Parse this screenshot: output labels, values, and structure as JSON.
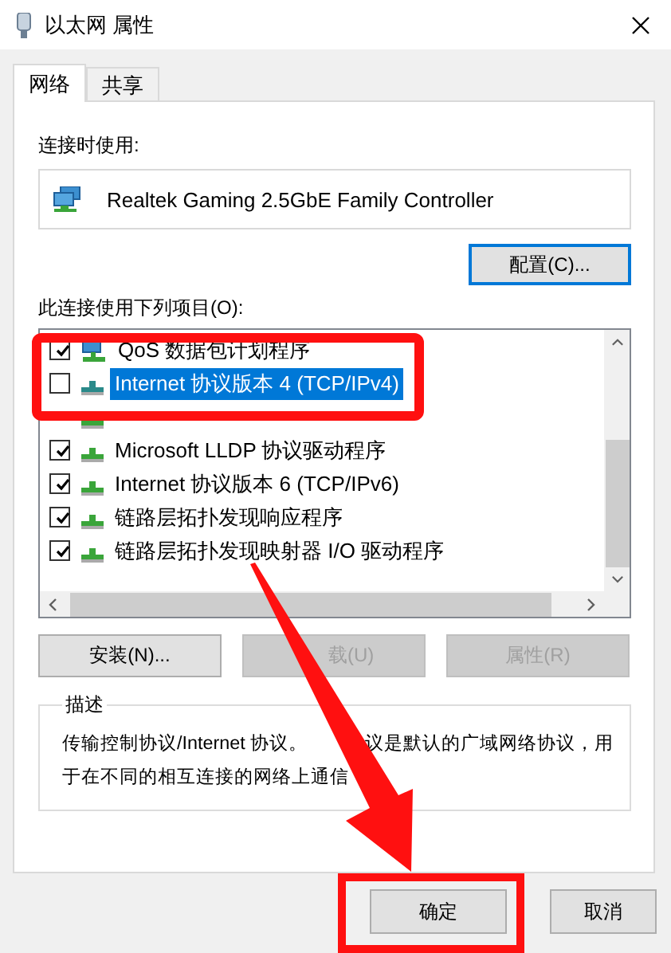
{
  "window": {
    "title": "以太网 属性"
  },
  "tabs": [
    {
      "label": "网络",
      "selected": true
    },
    {
      "label": "共享",
      "selected": false
    }
  ],
  "connect_using": {
    "label": "连接时使用:",
    "adapter": "Realtek Gaming 2.5GbE Family Controller",
    "configure_button": "配置(C)..."
  },
  "components": {
    "label": "此连接使用下列项目(O):",
    "items": [
      {
        "kind": "service",
        "label": "QoS 数据包计划程序",
        "checked": true,
        "selected": false
      },
      {
        "kind": "protocol",
        "label": "Internet 协议版本 4 (TCP/IPv4)",
        "checked": false,
        "selected": true
      },
      {
        "kind": "protocol"
      },
      {
        "kind": "protocol",
        "label": "Microsoft LLDP 协议驱动程序",
        "checked": true,
        "selected": false
      },
      {
        "kind": "protocol",
        "label": "Internet 协议版本 6 (TCP/IPv6)",
        "checked": true,
        "selected": false
      },
      {
        "kind": "protocol",
        "label": "链路层拓扑发现响应程序",
        "checked": true,
        "selected": false
      },
      {
        "kind": "protocol",
        "label": "链路层拓扑发现映射器 I/O 驱动程序",
        "checked": true,
        "selected": false
      }
    ]
  },
  "buttons": [
    {
      "label": "安装(N)...",
      "disabled": false
    },
    {
      "label": "载(U)",
      "disabled": true
    },
    {
      "label": "属性(R)",
      "disabled": true
    }
  ],
  "description": {
    "title": "描述",
    "lines": [
      [
        "传输控制协议/Internet 协议。",
        "议是默认的广域网络协议，用"
      ],
      [
        "于在不同的相互连接的网络上通信"
      ]
    ]
  },
  "footer_buttons": [
    {
      "label": "确定"
    },
    {
      "label": "取消"
    }
  ]
}
